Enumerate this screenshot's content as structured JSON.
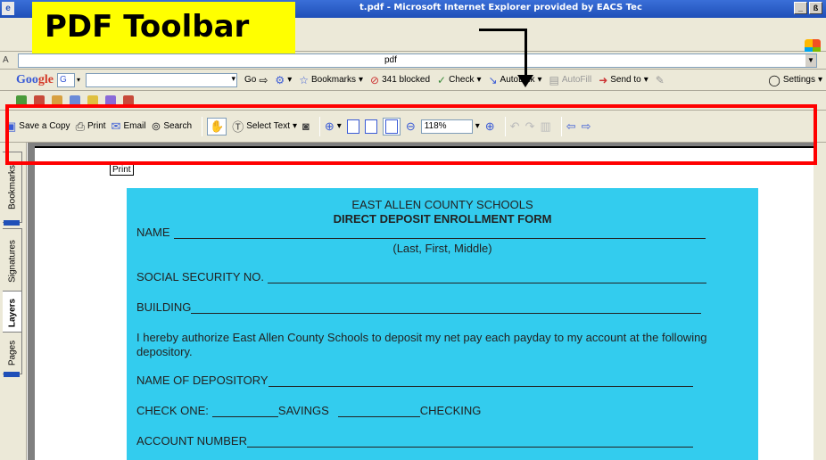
{
  "window": {
    "title": "t.pdf - Microsoft Internet Explorer provided by EACS Tec",
    "min_glyph": "_",
    "max_glyph": "ß",
    "close_glyph": "×"
  },
  "address": {
    "label": "A",
    "value": "pdf"
  },
  "googlebar": {
    "logo_a": "Goo",
    "logo_b": "gle",
    "g_btn": "G",
    "go": "Go",
    "bookmarks": "Bookmarks",
    "blocked": "341 blocked",
    "check": "Check",
    "autolink": "AutoLink",
    "autofill": "AutoFill",
    "send_to": "Send to",
    "settings": "Settings"
  },
  "pdf_toolbar": {
    "save_copy": "Save a Copy",
    "print": "Print",
    "email": "Email",
    "search": "Search",
    "select_text": "Select Text",
    "zoom": "118%"
  },
  "annotation": {
    "callout": "PDF Toolbar"
  },
  "nav_tabs": {
    "bookmarks": "Bookmarks",
    "signatures": "Signatures",
    "layers": "Layers",
    "pages": "Pages"
  },
  "tooltip": "Print",
  "form": {
    "school": "EAST ALLEN COUNTY SCHOOLS",
    "title": "DIRECT DEPOSIT ENROLLMENT FORM",
    "name_label": "NAME",
    "name_hint": "(Last, First, Middle)",
    "ssn_label": "SOCIAL SECURITY NO.",
    "building_label": "BUILDING",
    "authorization": "I hereby authorize East Allen County Schools to deposit my net pay each payday to my account at the following depository.",
    "depository_label": "NAME OF DEPOSITORY",
    "check_one_label": "CHECK ONE:",
    "savings": "SAVINGS",
    "checking": "CHECKING",
    "account_label": "ACCOUNT NUMBER"
  },
  "colors": {
    "form_bg": "#33ccee",
    "callout_bg": "#ffff00",
    "highlight_border": "#ff0000"
  }
}
